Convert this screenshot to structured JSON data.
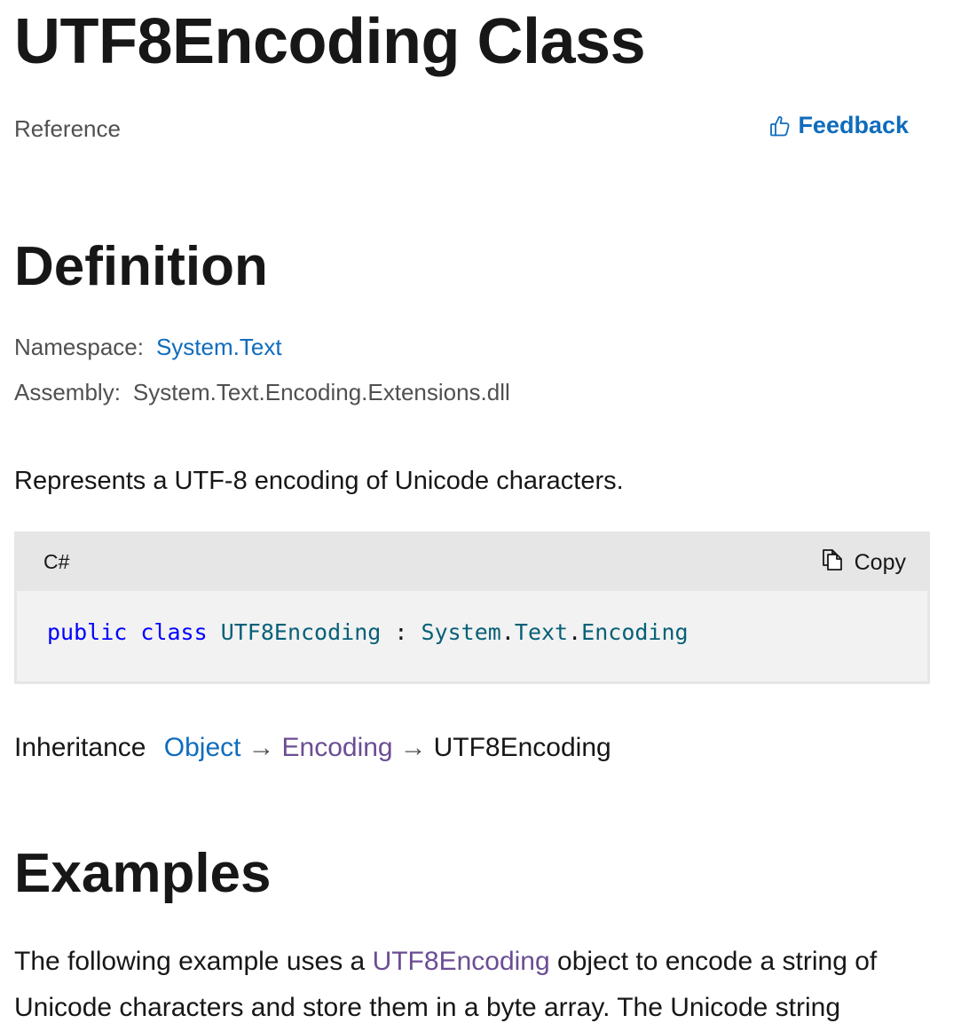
{
  "header": {
    "title": "UTF8Encoding Class",
    "reference_label": "Reference",
    "feedback_label": "Feedback"
  },
  "definition": {
    "heading": "Definition",
    "namespace_label": "Namespace:",
    "namespace_value": "System.Text",
    "assembly_label": "Assembly:",
    "assembly_value": "System.Text.Encoding.Extensions.dll",
    "summary": "Represents a UTF-8 encoding of Unicode characters."
  },
  "code_block": {
    "language": "C#",
    "copy_label": "Copy",
    "tokens": {
      "kw_public": "public",
      "kw_class": "class",
      "class_name": "UTF8Encoding",
      "colon": ":",
      "ns1": "System",
      "dot1": ".",
      "ns2": "Text",
      "dot2": ".",
      "base": "Encoding"
    }
  },
  "inheritance": {
    "label": "Inheritance",
    "items": [
      "Object",
      "Encoding",
      "UTF8Encoding"
    ],
    "arrow": "→"
  },
  "examples": {
    "heading": "Examples",
    "para_part1": "The following example uses a ",
    "para_link": "UTF8Encoding",
    "para_part2": " object to encode a string of Unicode characters and store them in a byte array. The Unicode string"
  },
  "colors": {
    "link_blue": "#0f6cbd",
    "link_visited": "#6b4d94",
    "keyword": "#0000ff",
    "type": "#076078"
  },
  "icons": {
    "feedback": "thumbs-up-icon",
    "copy": "copy-icon"
  }
}
